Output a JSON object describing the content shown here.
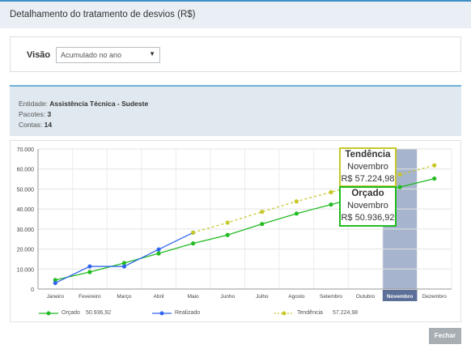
{
  "dialog": {
    "title": "Detalhamento do tratamento de desvios (R$)"
  },
  "visao": {
    "label": "Visão",
    "selected": "Acumulado no ano",
    "caret": "▼"
  },
  "info": {
    "entidade_label": "Entidade:",
    "entidade": "Assistência Técnica - Sudeste",
    "pacotes_label": "Pacotes:",
    "pacotes": "3",
    "contas_label": "Contas:",
    "contas": "14"
  },
  "colors": {
    "orcado": "#22bb22",
    "realizado": "#3366ee",
    "tendencia": "#c8c82a",
    "highlight": "#8a9bbd"
  },
  "chart_data": {
    "type": "line",
    "categories": [
      "Janeiro",
      "Fevereiro",
      "Março",
      "Abril",
      "Maio",
      "Junho",
      "Julho",
      "Agosto",
      "Setembro",
      "Outubro",
      "Novembro",
      "Dezembro"
    ],
    "y_ticks": [
      "0",
      "10.000",
      "20.000",
      "30.000",
      "40.000",
      "50.000",
      "60.000",
      "70.000"
    ],
    "ylim": [
      0,
      70000
    ],
    "highlight_category": "Novembro",
    "series": [
      {
        "name": "Orçado",
        "values": [
          4500,
          8500,
          13000,
          17800,
          22800,
          27000,
          32500,
          37700,
          42200,
          46800,
          50937,
          55200
        ]
      },
      {
        "name": "Realizado",
        "values": [
          3000,
          11300,
          11300,
          19800,
          28200,
          null,
          null,
          null,
          null,
          null,
          null,
          null
        ]
      },
      {
        "name": "Tendência",
        "values": [
          null,
          null,
          null,
          null,
          28200,
          33200,
          38600,
          43800,
          48400,
          52800,
          57225,
          61800
        ]
      }
    ]
  },
  "tooltips": {
    "tendencia": {
      "title": "Tendência",
      "month": "Novembro",
      "value": "R$ 57.224,98"
    },
    "orcado": {
      "title": "Orçado",
      "month": "Novembro",
      "value": "R$ 50.936,92"
    }
  },
  "legend": {
    "orcado": {
      "label": "Orçado",
      "value": "50.936,92"
    },
    "realizado": {
      "label": "Realizado",
      "value": ""
    },
    "tendencia": {
      "label": "Tendência",
      "value": "57.224,98"
    }
  },
  "buttons": {
    "fechar": "Fechar"
  }
}
